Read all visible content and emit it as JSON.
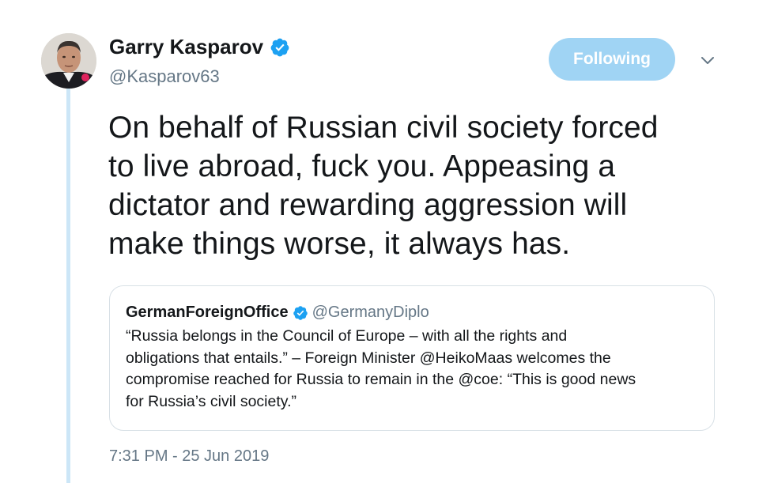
{
  "author": {
    "display_name": "Garry Kasparov",
    "handle": "@Kasparov63",
    "verified": true
  },
  "follow_button": {
    "label": "Following"
  },
  "tweet": {
    "text_lines": [
      "On behalf of Russian civil society forced",
      "to live abroad, fuck you. Appeasing a",
      "dictator and rewarding aggression will",
      "make things worse, it always has."
    ],
    "timestamp": "7:31 PM - 25 Jun 2019"
  },
  "quoted_tweet": {
    "display_name": "GermanForeignOffice",
    "handle": "@GermanyDiplo",
    "verified": true,
    "text_lines": [
      "“Russia belongs in the Council of Europe – with all the rights and",
      "obligations that entails.” – Foreign Minister @HeikoMaas welcomes the",
      "compromise reached for Russia to remain in the @coe: “This is good news",
      "for Russia’s civil society.”"
    ]
  },
  "icons": {
    "verified": "verified-badge-icon",
    "caret": "chevron-down-icon"
  },
  "colors": {
    "brand_blue": "#1da1f2",
    "follow_button_bg": "#a0d4f4",
    "thread_line": "#cce6f7",
    "secondary_text": "#657786",
    "primary_text": "#14171a",
    "quote_border": "#d8e0e6"
  }
}
